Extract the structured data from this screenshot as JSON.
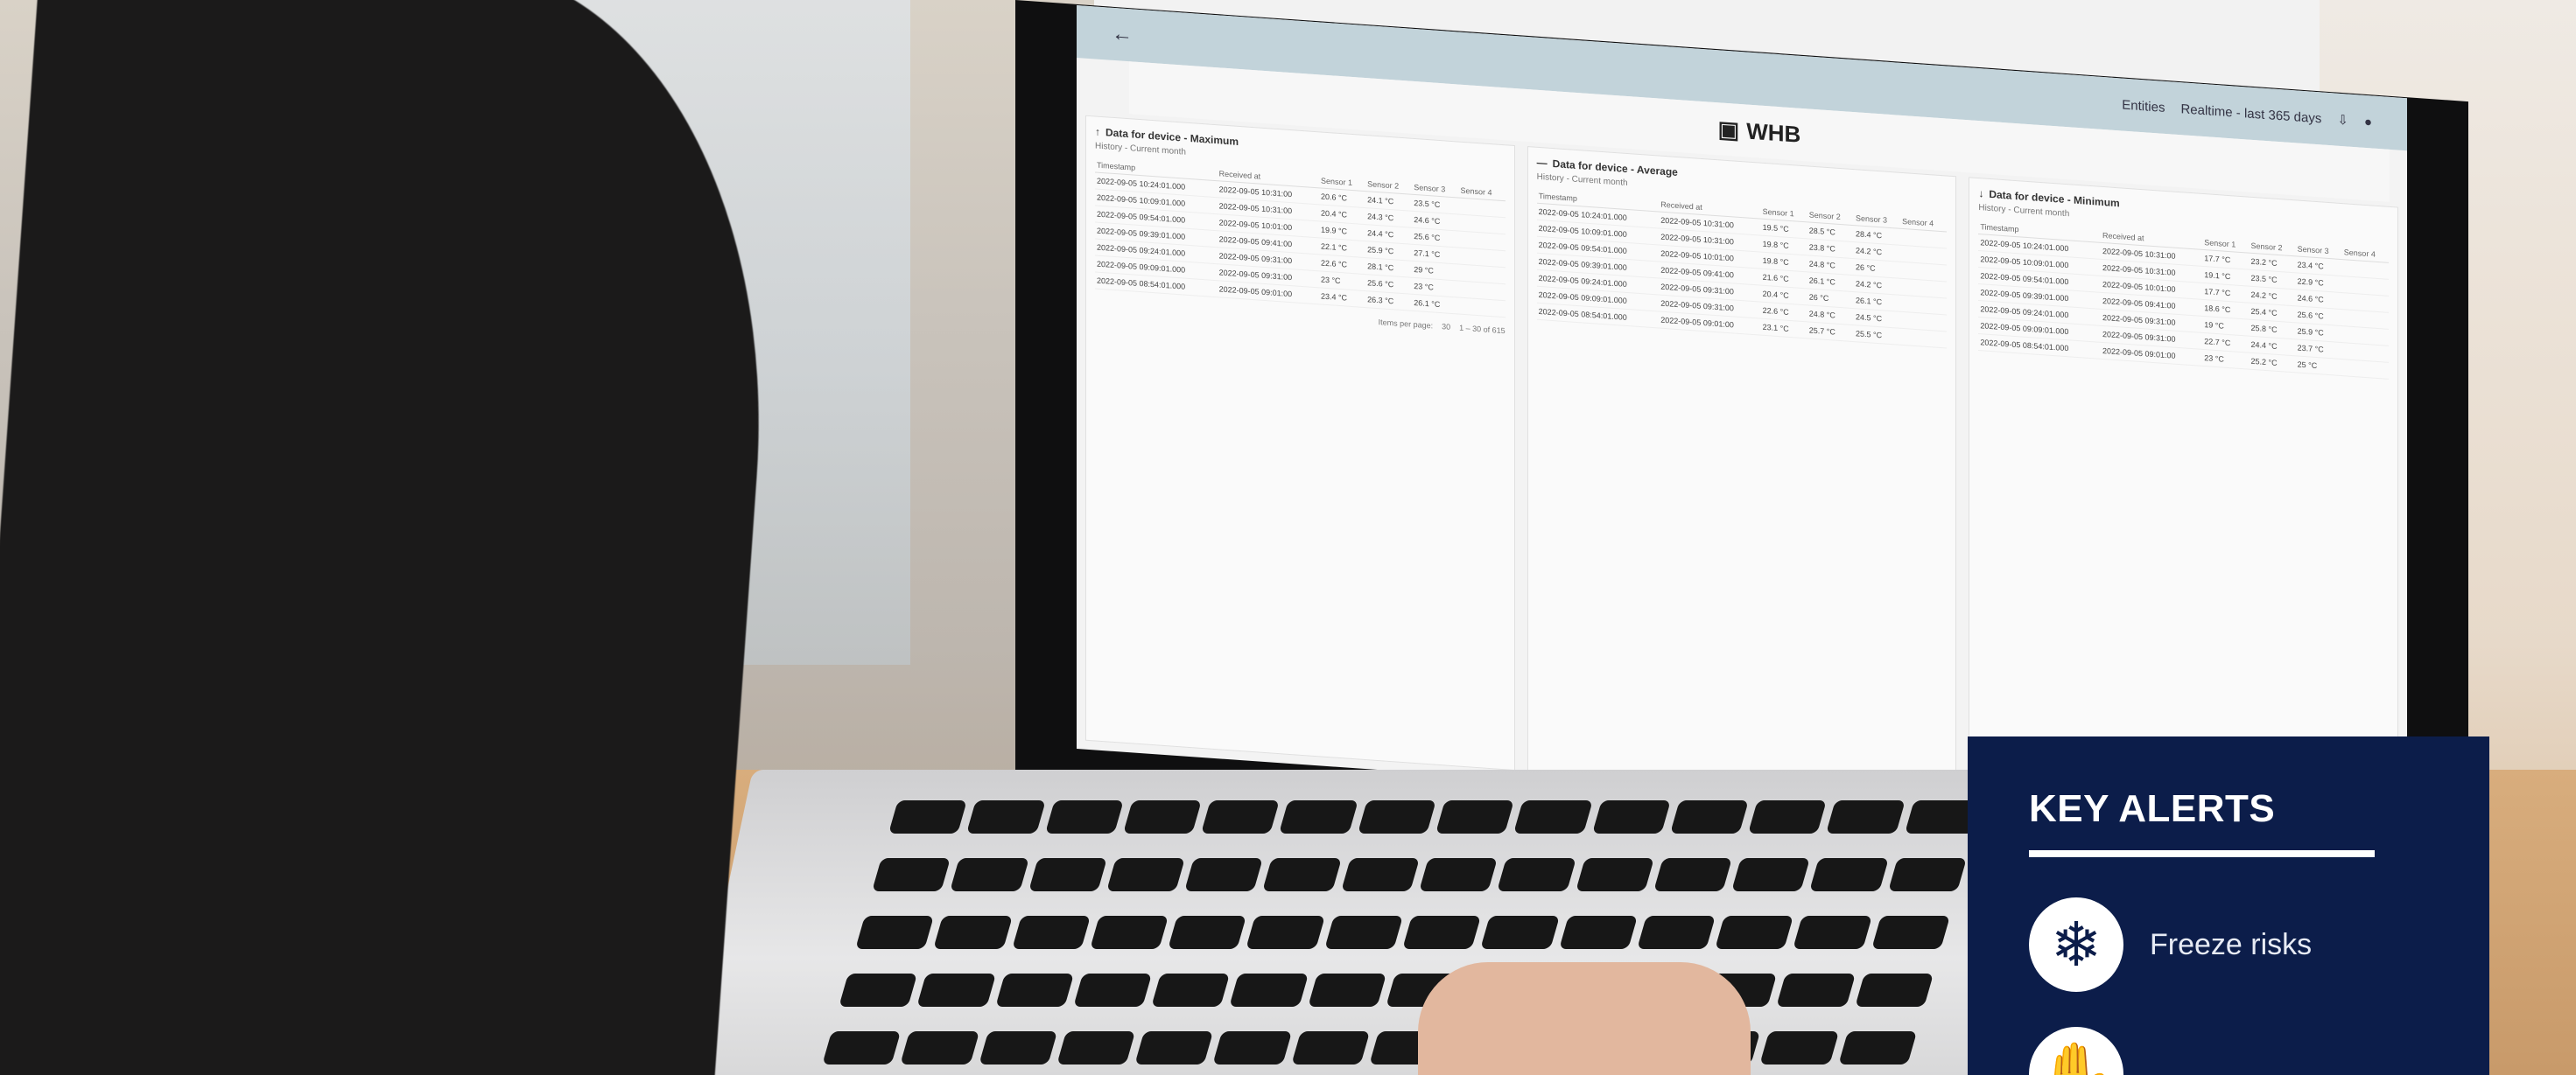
{
  "app": {
    "top_links": [
      "Entities",
      "Realtime - last 365 days"
    ],
    "title": "WHB"
  },
  "panels": [
    {
      "title": "Data for device - Maximum",
      "subtitle": "History - Current month",
      "columns": [
        "Timestamp",
        "Received at",
        "Sensor 1",
        "Sensor 2",
        "Sensor 3",
        "Sensor 4"
      ],
      "rows": [
        [
          "2022-09-05 10:24:01.000",
          "2022-09-05 10:31:00",
          "20.6 °C",
          "24.1 °C",
          "23.5 °C",
          ""
        ],
        [
          "2022-09-05 10:09:01.000",
          "2022-09-05 10:31:00",
          "20.4 °C",
          "24.3 °C",
          "24.6 °C",
          ""
        ],
        [
          "2022-09-05 09:54:01.000",
          "2022-09-05 10:01:00",
          "19.9 °C",
          "24.4 °C",
          "25.6 °C",
          ""
        ],
        [
          "2022-09-05 09:39:01.000",
          "2022-09-05 09:41:00",
          "22.1 °C",
          "25.9 °C",
          "27.1 °C",
          ""
        ],
        [
          "2022-09-05 09:24:01.000",
          "2022-09-05 09:31:00",
          "22.6 °C",
          "28.1 °C",
          "29 °C",
          ""
        ],
        [
          "2022-09-05 09:09:01.000",
          "2022-09-05 09:31:00",
          "23 °C",
          "25.6 °C",
          "23 °C",
          ""
        ],
        [
          "2022-09-05 08:54:01.000",
          "2022-09-05 09:01:00",
          "23.4 °C",
          "26.3 °C",
          "26.1 °C",
          ""
        ]
      ]
    },
    {
      "title": "Data for device - Average",
      "subtitle": "History - Current month",
      "columns": [
        "Timestamp",
        "Received at",
        "Sensor 1",
        "Sensor 2",
        "Sensor 3",
        "Sensor 4"
      ],
      "rows": [
        [
          "2022-09-05 10:24:01.000",
          "2022-09-05 10:31:00",
          "19.5 °C",
          "28.5 °C",
          "28.4 °C",
          ""
        ],
        [
          "2022-09-05 10:09:01.000",
          "2022-09-05 10:31:00",
          "19.8 °C",
          "23.8 °C",
          "24.2 °C",
          ""
        ],
        [
          "2022-09-05 09:54:01.000",
          "2022-09-05 10:01:00",
          "19.8 °C",
          "24.8 °C",
          "26 °C",
          ""
        ],
        [
          "2022-09-05 09:39:01.000",
          "2022-09-05 09:41:00",
          "21.6 °C",
          "26.1 °C",
          "24.2 °C",
          ""
        ],
        [
          "2022-09-05 09:24:01.000",
          "2022-09-05 09:31:00",
          "20.4 °C",
          "26 °C",
          "26.1 °C",
          ""
        ],
        [
          "2022-09-05 09:09:01.000",
          "2022-09-05 09:31:00",
          "22.6 °C",
          "24.8 °C",
          "24.5 °C",
          ""
        ],
        [
          "2022-09-05 08:54:01.000",
          "2022-09-05 09:01:00",
          "23.1 °C",
          "25.7 °C",
          "25.5 °C",
          ""
        ]
      ]
    },
    {
      "title": "Data for device - Minimum",
      "subtitle": "History - Current month",
      "columns": [
        "Timestamp",
        "Received at",
        "Sensor 1",
        "Sensor 2",
        "Sensor 3",
        "Sensor 4"
      ],
      "rows": [
        [
          "2022-09-05 10:24:01.000",
          "2022-09-05 10:31:00",
          "17.7 °C",
          "23.2 °C",
          "23.4 °C",
          ""
        ],
        [
          "2022-09-05 10:09:01.000",
          "2022-09-05 10:31:00",
          "19.1 °C",
          "23.5 °C",
          "22.9 °C",
          ""
        ],
        [
          "2022-09-05 09:54:01.000",
          "2022-09-05 10:01:00",
          "17.7 °C",
          "24.2 °C",
          "24.6 °C",
          ""
        ],
        [
          "2022-09-05 09:39:01.000",
          "2022-09-05 09:41:00",
          "18.6 °C",
          "25.4 °C",
          "25.6 °C",
          ""
        ],
        [
          "2022-09-05 09:24:01.000",
          "2022-09-05 09:31:00",
          "19 °C",
          "25.8 °C",
          "25.9 °C",
          ""
        ],
        [
          "2022-09-05 09:09:01.000",
          "2022-09-05 09:31:00",
          "22.7 °C",
          "24.4 °C",
          "23.7 °C",
          ""
        ],
        [
          "2022-09-05 08:54:01.000",
          "2022-09-05 09:01:00",
          "23 °C",
          "25.2 °C",
          "25 °C",
          ""
        ]
      ]
    }
  ],
  "pager": {
    "label": "Items per page:",
    "size": "30",
    "range": "1 – 30 of 615"
  },
  "alerts": {
    "title": "KEY ALERTS",
    "items": [
      {
        "label": "Freeze risks",
        "icon": "snowflake-icon"
      }
    ],
    "colors": {
      "panel": "#0c1d4a",
      "text": "#ffffff"
    }
  }
}
